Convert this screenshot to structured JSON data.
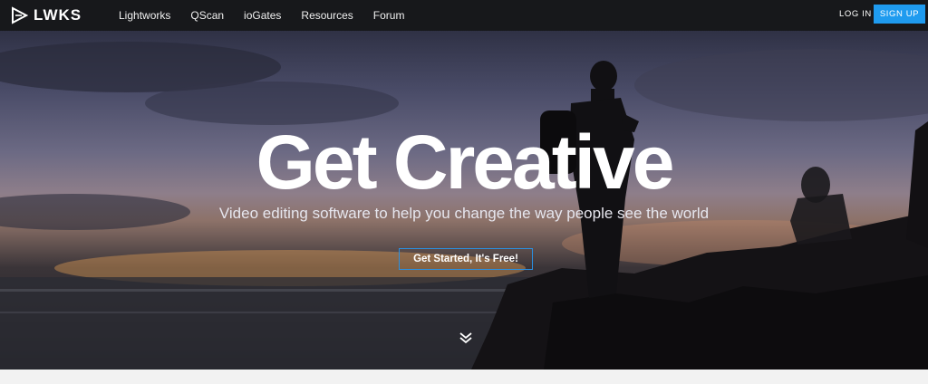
{
  "brand": {
    "name": "LWKS"
  },
  "nav": {
    "links": [
      "Lightworks",
      "QScan",
      "ioGates",
      "Resources",
      "Forum"
    ],
    "login": "LOG IN",
    "signup": "SIGN UP"
  },
  "hero": {
    "headline": "Get Creative",
    "subline": "Video editing software to help you change the way people see the world",
    "cta": "Get Started, It's Free!"
  },
  "colors": {
    "nav_bg": "#17181b",
    "accent": "#1f9bef"
  },
  "icons": {
    "logo": "play-triangle-logo-icon",
    "scroll": "double-chevron-down-icon"
  }
}
